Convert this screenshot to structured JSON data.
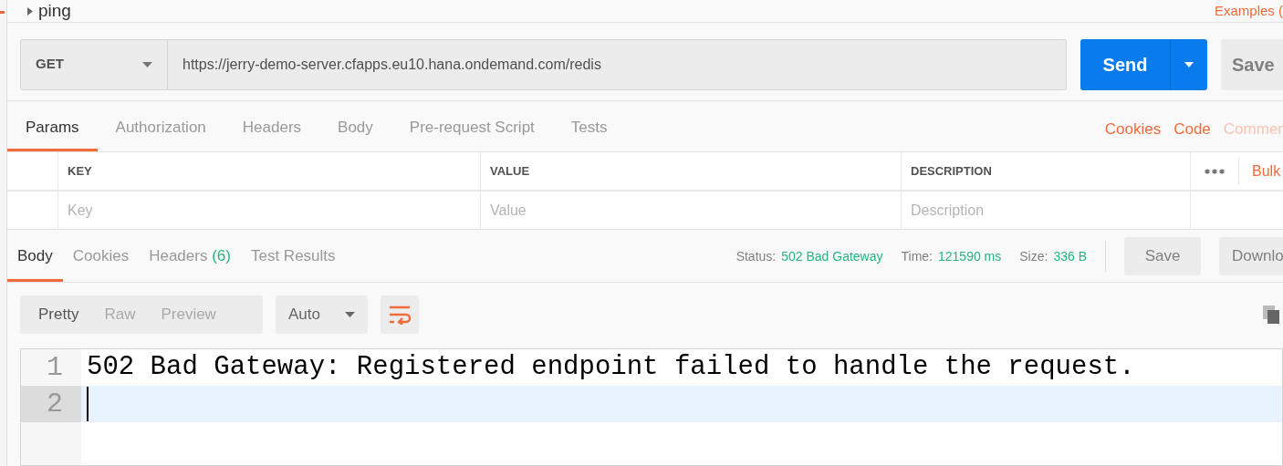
{
  "request_name": "ping",
  "examples_link": "Examples (",
  "method": "GET",
  "url": "https://jerry-demo-server.cfapps.eu10.hana.ondemand.com/redis",
  "send_button": "Send",
  "save_button": "Save",
  "request_tabs": [
    {
      "label": "Params",
      "selected": true
    },
    {
      "label": "Authorization",
      "selected": false
    },
    {
      "label": "Headers",
      "selected": false
    },
    {
      "label": "Body",
      "selected": false
    },
    {
      "label": "Pre-request Script",
      "selected": false
    },
    {
      "label": "Tests",
      "selected": false
    }
  ],
  "request_links": [
    {
      "label": "Cookies",
      "disabled": false
    },
    {
      "label": "Code",
      "disabled": false
    },
    {
      "label": "Commer",
      "disabled": true
    }
  ],
  "params_table": {
    "columns": [
      "KEY",
      "VALUE",
      "DESCRIPTION"
    ],
    "bulk_edit": "Bulk",
    "placeholders": [
      "Key",
      "Value",
      "Description"
    ]
  },
  "response_tabs": [
    {
      "label": "Body",
      "selected": true
    },
    {
      "label": "Cookies",
      "selected": false
    },
    {
      "label": "Headers",
      "count": "(6)",
      "selected": false
    },
    {
      "label": "Test Results",
      "selected": false
    }
  ],
  "response_meta": [
    {
      "label": "Status:",
      "value": "502 Bad Gateway"
    },
    {
      "label": "Time:",
      "value": "121590 ms"
    },
    {
      "label": "Size:",
      "value": "336 B"
    }
  ],
  "response_buttons": [
    "Save",
    "Downlo"
  ],
  "format_tabs": [
    {
      "label": "Pretty",
      "selected": true
    },
    {
      "label": "Raw",
      "selected": false
    },
    {
      "label": "Preview",
      "selected": false
    }
  ],
  "format_select": "Auto",
  "editor_lines": [
    {
      "number": "1",
      "text": "502 Bad Gateway: Registered endpoint failed to handle the request.",
      "active": false
    },
    {
      "number": "2",
      "active": true
    }
  ]
}
